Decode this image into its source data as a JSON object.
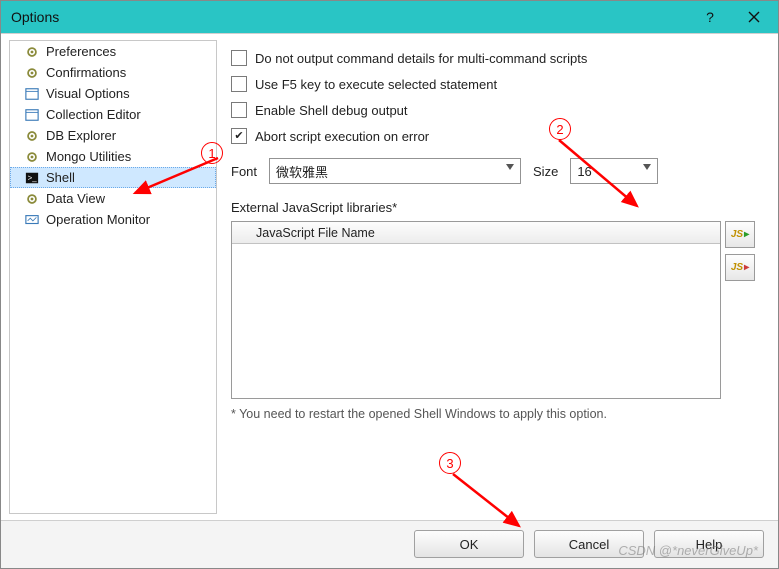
{
  "title": "Options",
  "sidebar": {
    "items": [
      {
        "label": "Preferences",
        "icon": "gear-icon",
        "selected": false
      },
      {
        "label": "Confirmations",
        "icon": "gear-icon",
        "selected": false
      },
      {
        "label": "Visual Options",
        "icon": "panel-icon",
        "selected": false
      },
      {
        "label": "Collection Editor",
        "icon": "panel-icon",
        "selected": false
      },
      {
        "label": "DB Explorer",
        "icon": "gear-icon",
        "selected": false
      },
      {
        "label": "Mongo Utilities",
        "icon": "gear-icon",
        "selected": false
      },
      {
        "label": "Shell",
        "icon": "console-icon",
        "selected": true
      },
      {
        "label": "Data View",
        "icon": "gear-icon",
        "selected": false
      },
      {
        "label": "Operation Monitor",
        "icon": "monitor-icon",
        "selected": false
      }
    ]
  },
  "options": {
    "chk_no_output": {
      "label": "Do not output command details for multi-command scripts",
      "checked": false
    },
    "chk_f5_execute": {
      "label": "Use F5 key to execute selected statement",
      "checked": false
    },
    "chk_debug_output": {
      "label": "Enable Shell debug output",
      "checked": false
    },
    "chk_abort_error": {
      "label": "Abort script execution on error",
      "checked": true
    }
  },
  "font": {
    "label": "Font",
    "value": "微软雅黑"
  },
  "size": {
    "label": "Size",
    "value": "16"
  },
  "external_js": {
    "label": "External JavaScript libraries*",
    "column": "JavaScript File Name",
    "rows": []
  },
  "footnote": "* You need to restart the opened Shell Windows to apply this option.",
  "buttons": {
    "ok": "OK",
    "cancel": "Cancel",
    "help": "Help"
  },
  "annotations": {
    "one": "1",
    "two": "2",
    "three": "3"
  },
  "watermark": "CSDN @*neverGiveUp*"
}
